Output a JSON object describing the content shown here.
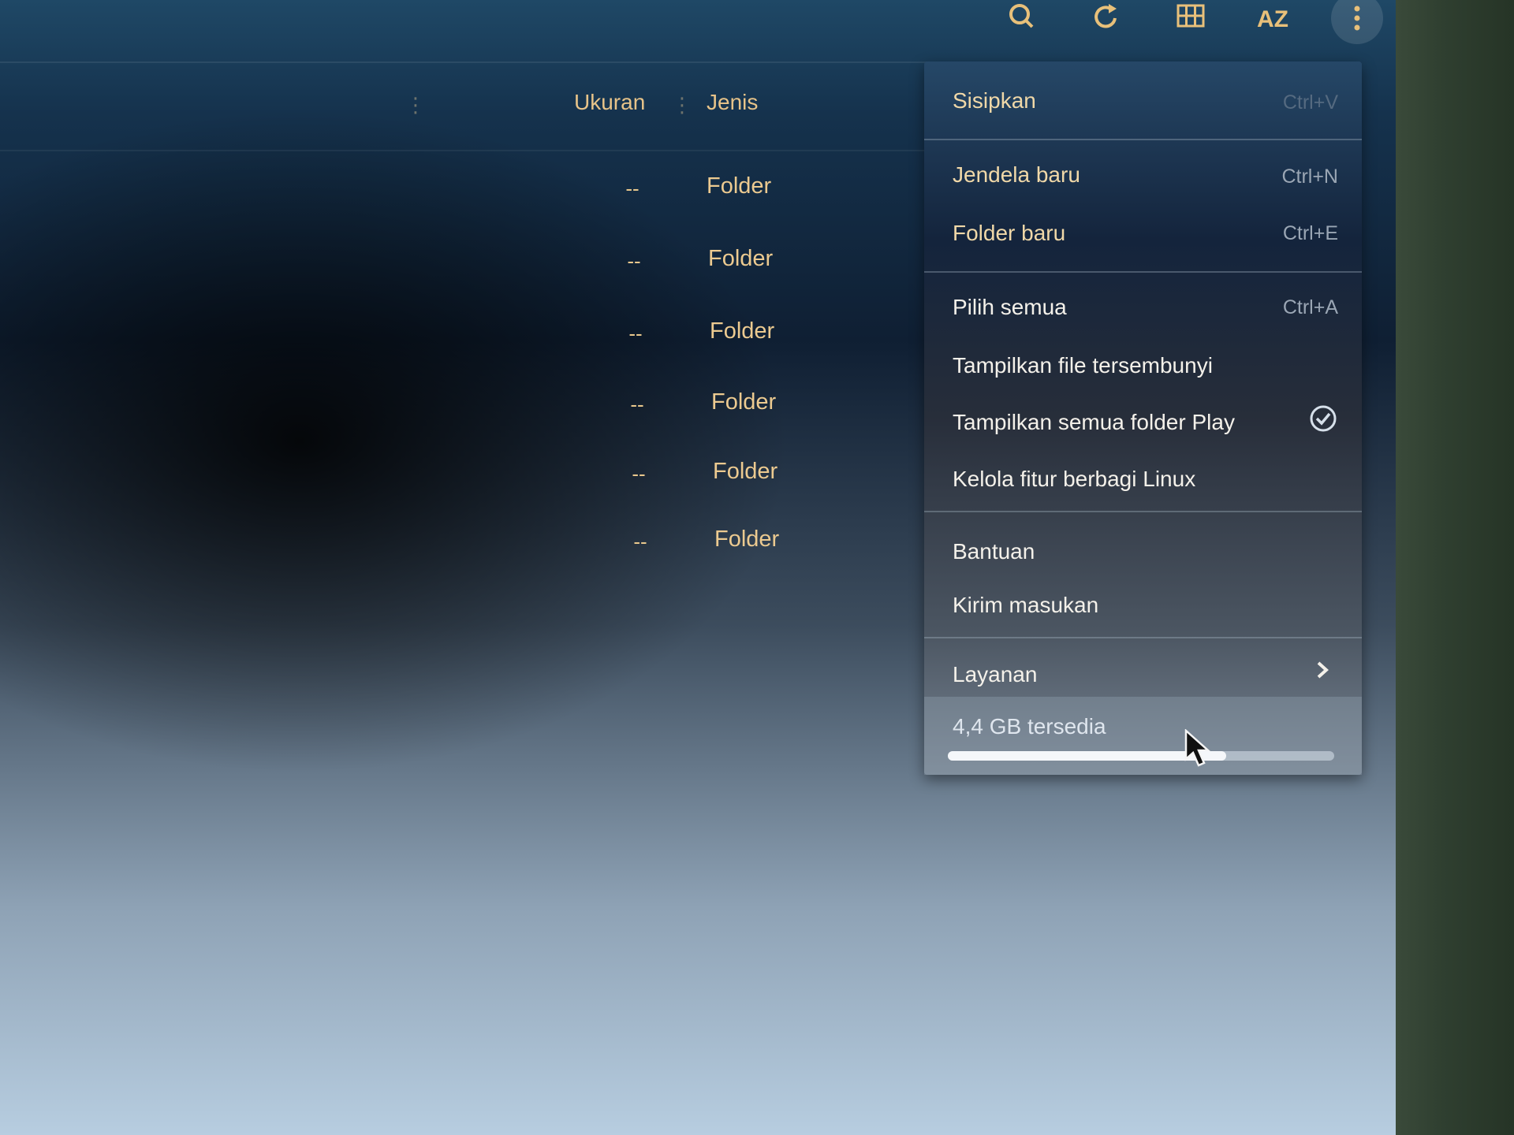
{
  "toolbar": {
    "icons": [
      "search-icon",
      "refresh-icon",
      "grid-view-icon",
      "sort-az-icon",
      "more-vert-icon"
    ],
    "sort_label": "AZ"
  },
  "columns": {
    "size": "Ukuran",
    "type": "Jenis"
  },
  "rows": [
    {
      "size": "--",
      "type": "Folder"
    },
    {
      "size": "--",
      "type": "Folder"
    },
    {
      "size": "--",
      "type": "Folder"
    },
    {
      "size": "--",
      "type": "Folder"
    },
    {
      "size": "--",
      "type": "Folder"
    },
    {
      "size": "--",
      "type": "Folder"
    }
  ],
  "menu": {
    "paste": {
      "label": "Sisipkan",
      "shortcut": "Ctrl+V"
    },
    "new_window": {
      "label": "Jendela baru",
      "shortcut": "Ctrl+N"
    },
    "new_folder": {
      "label": "Folder baru",
      "shortcut": "Ctrl+E"
    },
    "select_all": {
      "label": "Pilih semua",
      "shortcut": "Ctrl+A"
    },
    "show_hidden": {
      "label": "Tampilkan file tersembunyi"
    },
    "show_play": {
      "label": "Tampilkan semua folder Play",
      "checked": true
    },
    "linux_sharing": {
      "label": "Kelola fitur berbagi Linux"
    },
    "help": {
      "label": "Bantuan"
    },
    "feedback": {
      "label": "Kirim masukan"
    },
    "services": {
      "label": "Layanan"
    },
    "storage": {
      "label": "4,4 GB tersedia",
      "used_fraction": 0.72
    }
  },
  "colors": {
    "accent_text": "#e7c389",
    "menu_text": "#f4f1ea",
    "shortcut_text": "#9aa6b4"
  }
}
